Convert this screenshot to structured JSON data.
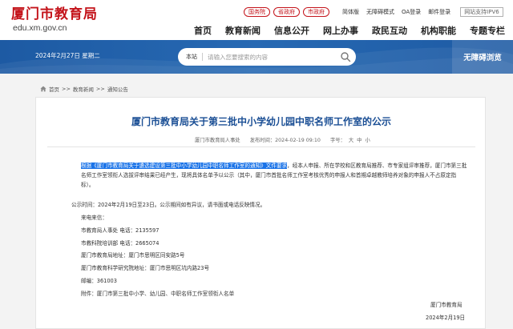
{
  "header": {
    "logo_cn": "厦门市教育局",
    "logo_en": "edu.xm.gov.cn",
    "badges": [
      "国务院",
      "省政府",
      "市政府"
    ],
    "links": [
      "简体版",
      "无障碍模式",
      "OA登录",
      "邮件登录"
    ],
    "ipv6": "网站支持IPV6"
  },
  "nav": [
    "首页",
    "教育新闻",
    "信息公开",
    "网上办事",
    "政民互动",
    "机构职能",
    "专题专栏"
  ],
  "banner": {
    "date": "2024年2月27日  星期二",
    "site_label": "本站",
    "search_placeholder": "请输入您要搜索的内容",
    "barrier_free": "无障碍浏览"
  },
  "breadcrumb": [
    "首页",
    "教育新闻",
    "通知公告"
  ],
  "article": {
    "title": "厦门市教育局关于第三批中小学幼儿园中职名师工作室的公示",
    "source": "厦门市教育局人事处",
    "published": "发布时间：2024-02-19 09:10",
    "font_size_label": "字号：",
    "font_sizes": [
      "大",
      "中",
      "小"
    ],
    "para1_highlight": "根据《厦门市教育局关于遴选建设第三批中小学幼儿园中职名师工作室的通知》文件要求",
    "para1_rest": "，经本人申报、所在学校和区教育局推荐、市专家组评审推荐，厦门市第三批名师工作室领衔人选拔评审结果已经产生，现将具体名单予以公示（其中，厦门市首批名师工作室考核优秀的申报人和首期卓越教师培养对象的申报人不占原定指标）。",
    "lines": [
      "公示时间：2024年2月19日至23日。公示期间如有异议，请书面或电话反映情况。",
      "来电来信：",
      "市教育局人事处   电话：2135597",
      "市教科院培训部   电话：2665074",
      "厦门市教育局地址：厦门市思明区同安路5号",
      "厦门市教育科学研究院地址：厦门市思明区坑内路23号",
      "邮编：361003",
      "附件：厦门市第三批中小学、幼儿园、中职名师工作室领衔人名单"
    ],
    "signature": "厦门市教育局",
    "sign_date": "2024年2月19日"
  }
}
